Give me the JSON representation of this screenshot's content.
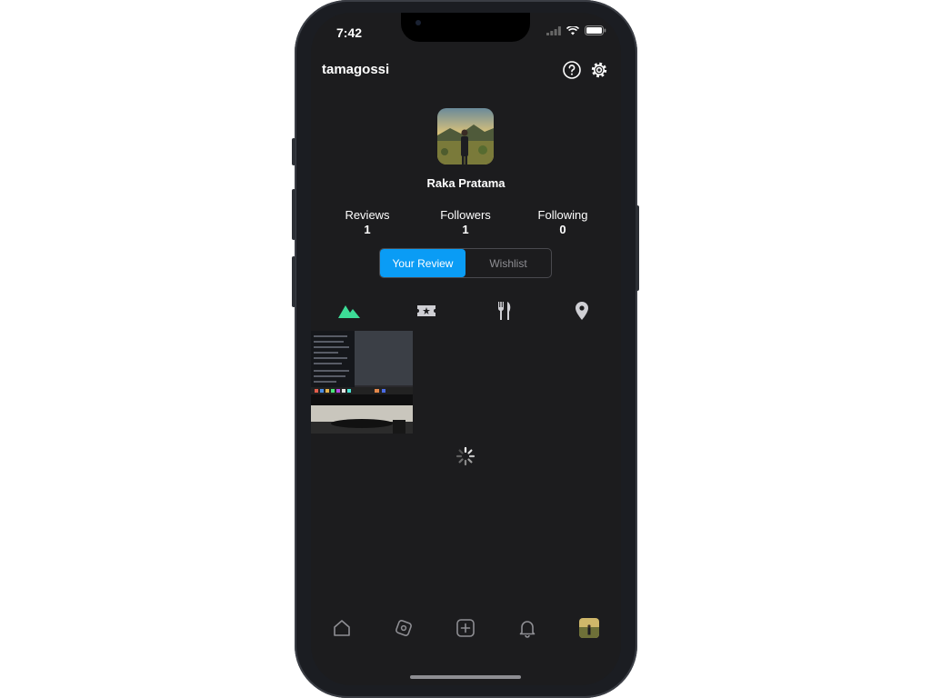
{
  "status_bar": {
    "time": "7:42"
  },
  "profile": {
    "username": "tamagossi",
    "display_name": "Raka Pratama",
    "stats": [
      {
        "label": "Reviews",
        "value": "1"
      },
      {
        "label": "Followers",
        "value": "1"
      },
      {
        "label": "Following",
        "value": "0"
      }
    ]
  },
  "segmented": {
    "selected": "Your Review",
    "other": "Wishlist"
  },
  "category_icons": [
    "mountain-icon",
    "ticket-icon",
    "fork-knife-icon",
    "map-pin-icon"
  ],
  "tab_bar_icons": [
    "home-icon",
    "compass-icon",
    "plus-square-icon",
    "bell-icon",
    "profile-avatar"
  ],
  "colors": {
    "accent": "#0a9cf5",
    "active_category": "#3ddc97",
    "background": "#1c1c1e"
  }
}
